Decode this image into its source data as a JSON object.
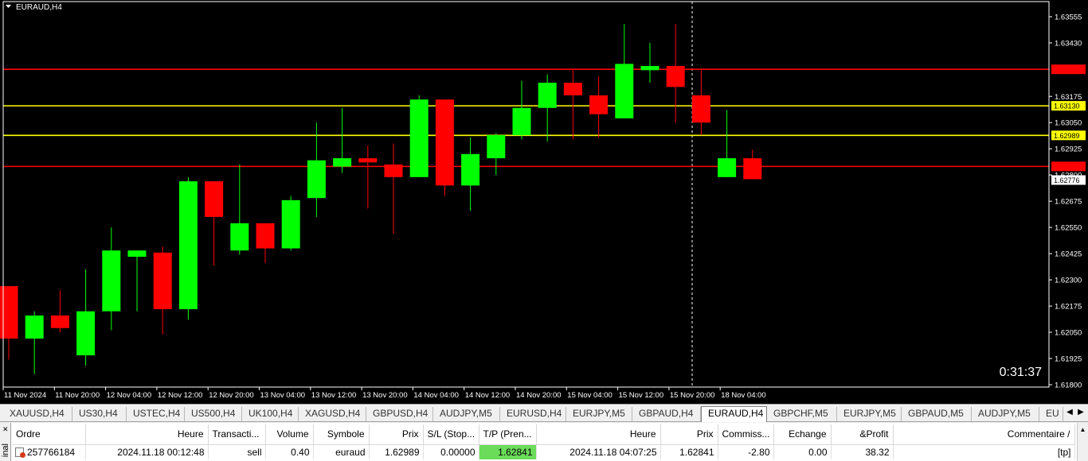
{
  "chart": {
    "title": "EURAUD,H4",
    "timer": "0:31:37",
    "price_axis": [
      "1.63555",
      "1.63430",
      "1.63175",
      "1.63050",
      "1.62925",
      "1.62800",
      "1.62675",
      "1.62550",
      "1.62425",
      "1.62300",
      "1.62175",
      "1.62050",
      "1.61925",
      "1.61800"
    ],
    "price_tags": [
      {
        "label": "1.63304",
        "price": 1.63304,
        "color": "#ff0000",
        "text_color": "#ff0000"
      },
      {
        "label": "1.63130",
        "price": 1.6313,
        "color": "#ffff00",
        "text_color": "#000000"
      },
      {
        "label": "1.62989",
        "price": 1.62989,
        "color": "#ffff00",
        "text_color": "#000000"
      },
      {
        "label": "1.62841",
        "price": 1.62841,
        "color": "#ff0000",
        "text_color": "#ff0000"
      },
      {
        "label": "1.62776",
        "price": 1.62776,
        "color": "#ffffff",
        "text_color": "#000000"
      }
    ],
    "time_axis": [
      "11 Nov 2024",
      "11 Nov 20:00",
      "12 Nov 04:00",
      "12 Nov 12:00",
      "12 Nov 20:00",
      "13 Nov 04:00",
      "13 Nov 12:00",
      "13 Nov 20:00",
      "14 Nov 04:00",
      "14 Nov 12:00",
      "14 Nov 20:00",
      "15 Nov 04:00",
      "15 Nov 12:00",
      "15 Nov 20:00",
      "18 Nov 04:00"
    ],
    "colors": {
      "bull": "#00ff00",
      "bear": "#ff0000",
      "background": "#000000",
      "axis_text": "#ffffff"
    }
  },
  "chart_data": {
    "type": "candlestick",
    "title": "EURAUD,H4",
    "ylim": [
      1.618,
      1.636
    ],
    "candles": [
      {
        "o": 1.6227,
        "h": 1.6227,
        "l": 1.6192,
        "c": 1.6202
      },
      {
        "o": 1.6202,
        "h": 1.6215,
        "l": 1.6185,
        "c": 1.6213
      },
      {
        "o": 1.6213,
        "h": 1.6225,
        "l": 1.6205,
        "c": 1.6207
      },
      {
        "o": 1.6194,
        "h": 1.6235,
        "l": 1.6189,
        "c": 1.6215
      },
      {
        "o": 1.6215,
        "h": 1.6255,
        "l": 1.6206,
        "c": 1.6244
      },
      {
        "o": 1.6241,
        "h": 1.6244,
        "l": 1.6215,
        "c": 1.6244
      },
      {
        "o": 1.6243,
        "h": 1.6246,
        "l": 1.6204,
        "c": 1.6216
      },
      {
        "o": 1.6216,
        "h": 1.6279,
        "l": 1.6211,
        "c": 1.6277
      },
      {
        "o": 1.6277,
        "h": 1.6277,
        "l": 1.6237,
        "c": 1.626
      },
      {
        "o": 1.6244,
        "h": 1.6285,
        "l": 1.6242,
        "c": 1.6257
      },
      {
        "o": 1.6257,
        "h": 1.6257,
        "l": 1.6238,
        "c": 1.6245
      },
      {
        "o": 1.6245,
        "h": 1.627,
        "l": 1.6244,
        "c": 1.6268
      },
      {
        "o": 1.6269,
        "h": 1.6305,
        "l": 1.626,
        "c": 1.6287
      },
      {
        "o": 1.6284,
        "h": 1.6312,
        "l": 1.6281,
        "c": 1.6288
      },
      {
        "o": 1.6288,
        "h": 1.6294,
        "l": 1.6264,
        "c": 1.6286
      },
      {
        "o": 1.6285,
        "h": 1.6295,
        "l": 1.6252,
        "c": 1.6279
      },
      {
        "o": 1.6279,
        "h": 1.6318,
        "l": 1.6279,
        "c": 1.6316
      },
      {
        "o": 1.6316,
        "h": 1.6316,
        "l": 1.627,
        "c": 1.6275
      },
      {
        "o": 1.6275,
        "h": 1.6298,
        "l": 1.6263,
        "c": 1.629
      },
      {
        "o": 1.6288,
        "h": 1.63,
        "l": 1.628,
        "c": 1.6299
      },
      {
        "o": 1.6299,
        "h": 1.6325,
        "l": 1.6297,
        "c": 1.6312
      },
      {
        "o": 1.6312,
        "h": 1.6328,
        "l": 1.6296,
        "c": 1.6324
      },
      {
        "o": 1.6324,
        "h": 1.633,
        "l": 1.6297,
        "c": 1.6318
      },
      {
        "o": 1.6318,
        "h": 1.6327,
        "l": 1.6298,
        "c": 1.6309
      },
      {
        "o": 1.6307,
        "h": 1.6352,
        "l": 1.6307,
        "c": 1.6333
      },
      {
        "o": 1.633,
        "h": 1.6343,
        "l": 1.6324,
        "c": 1.6332
      },
      {
        "o": 1.6332,
        "h": 1.6352,
        "l": 1.6305,
        "c": 1.6322
      },
      {
        "o": 1.6318,
        "h": 1.633,
        "l": 1.6299,
        "c": 1.6305
      },
      {
        "o": 1.6279,
        "h": 1.6311,
        "l": 1.6279,
        "c": 1.6288
      },
      {
        "o": 1.6288,
        "h": 1.6292,
        "l": 1.6278,
        "c": 1.6278
      }
    ]
  },
  "tabs": [
    "XAUUSD,H4",
    "US30,H4",
    "USTEC,H4",
    "US500,H4",
    "UK100,H4",
    "XAGUSD,H4",
    "GBPUSD,H4",
    "AUDJPY,M5",
    "EURUSD,H4",
    "EURJPY,M5",
    "GBPAUD,H4",
    "EURAUD,H4",
    "GBPCHF,M5",
    "EURJPY,M5",
    "GBPAUD,M5",
    "AUDJPY,M5",
    "EU"
  ],
  "active_tab": "EURAUD,H4",
  "terminal": {
    "side_label": "inal",
    "columns": [
      "Ordre",
      "Heure",
      "Transacti...",
      "Volume",
      "Symbole",
      "Prix",
      "S/L (Stop...",
      "T/P (Pren...",
      "Heure",
      "Prix",
      "Commiss...",
      "Echange",
      "&Profit",
      "Commentaire"
    ],
    "rows": [
      [
        "257766184",
        "2024.11.18 00:12:48",
        "sell",
        "0.40",
        "euraud",
        "1.62989",
        "0.00000",
        "1.62841",
        "2024.11.18 04:07:25",
        "1.62841",
        "-2.80",
        "0.00",
        "38.32",
        "[tp]"
      ]
    ]
  }
}
